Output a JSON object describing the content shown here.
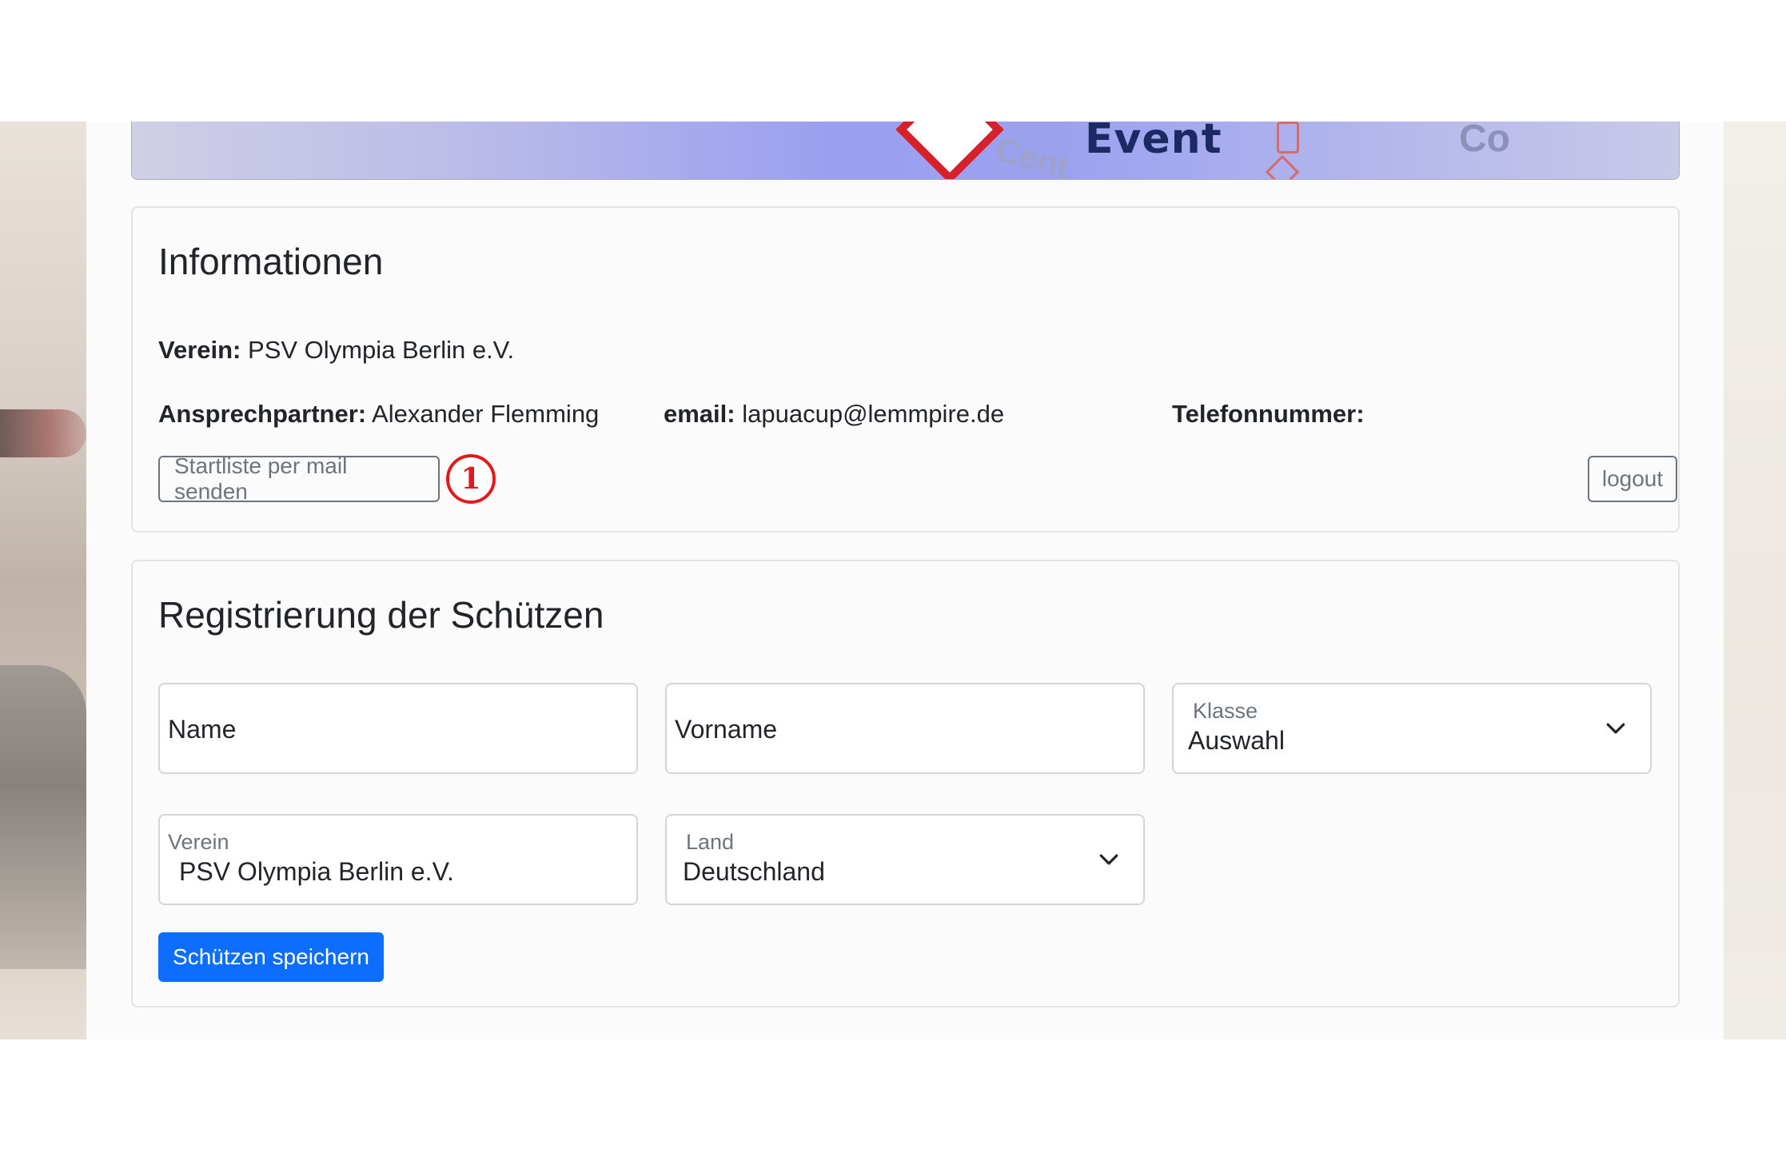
{
  "banner": {
    "event_text": "Event",
    "ghost_text_1": "Cent",
    "ghost_text_2": "Co"
  },
  "info": {
    "heading": "Informationen",
    "verein_label": "Verein:",
    "verein_value": "PSV Olympia Berlin e.V.",
    "contact_label": "Ansprechpartner:",
    "contact_value": "Alexander Flemming",
    "email_label": "email:",
    "email_value": "lapuacup@lemmpire.de",
    "phone_label": "Telefonnummer:",
    "phone_value": "",
    "send_button": "Startliste per mail senden",
    "marker": "1",
    "logout_button": "logout"
  },
  "registration": {
    "heading": "Registrierung der Schützen",
    "name_placeholder": "Name",
    "firstname_placeholder": "Vorname",
    "class_label": "Klasse",
    "class_value": "Auswahl",
    "club_label": "Verein",
    "club_value": "PSV Olympia Berlin e.V.",
    "country_label": "Land",
    "country_value": "Deutschland",
    "save_button": "Schützen speichern"
  },
  "colors": {
    "primary": "#0d6efd",
    "marker": "#e21a1a",
    "outline": "#6c757d"
  }
}
